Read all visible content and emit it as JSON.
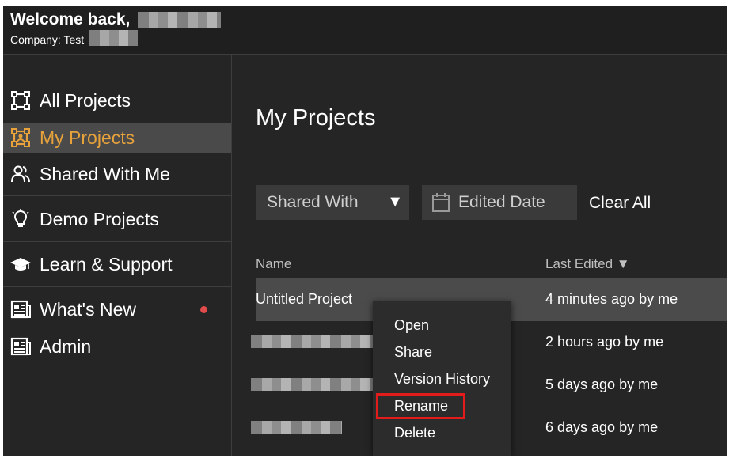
{
  "header": {
    "welcome": "Welcome back,",
    "company": "Company: Test"
  },
  "sidebar": {
    "items": [
      {
        "label": "All Projects",
        "icon": "frame-icon"
      },
      {
        "label": "My Projects",
        "icon": "user-frame-icon",
        "active": true
      },
      {
        "label": "Shared With Me",
        "icon": "users-icon"
      },
      {
        "label": "Demo Projects",
        "icon": "lightbulb-icon"
      },
      {
        "label": "Learn & Support",
        "icon": "graduation-cap-icon"
      },
      {
        "label": "What's New",
        "icon": "newspaper-icon",
        "badge": "notification-dot"
      },
      {
        "label": "Admin",
        "icon": "newspaper-icon"
      }
    ],
    "accent_color": "#e7a23b"
  },
  "main": {
    "title": "My Projects",
    "filters": {
      "shared_with": "Shared With",
      "arrow": "▼",
      "edited_date": "Edited Date",
      "clear_all": "Clear All"
    },
    "columns": {
      "name": "Name",
      "last_edited": "Last Edited ▼"
    },
    "rows": [
      {
        "name": "Untitled Project",
        "edited": "4 minutes ago by me"
      },
      {
        "name": "",
        "edited": "2 hours ago by me"
      },
      {
        "name": "",
        "edited": "5 days ago by me"
      },
      {
        "name": "",
        "edited": "6 days ago by me"
      }
    ],
    "context_menu": {
      "items": [
        "Open",
        "Share",
        "Version History",
        "Rename",
        "Delete"
      ],
      "highlighted": "Rename",
      "highlight_color": "#e21b1b"
    }
  }
}
